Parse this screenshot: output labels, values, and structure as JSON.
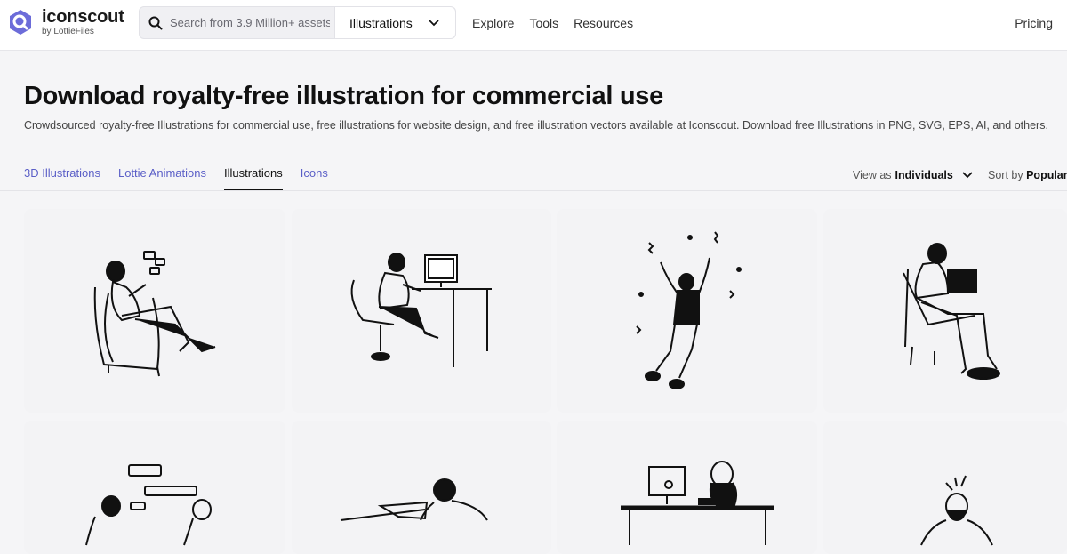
{
  "header": {
    "logo_name": "iconscout",
    "logo_sub": "by LottieFiles",
    "search_placeholder": "Search from 3.9 Million+ assets",
    "search_category": "Illustrations",
    "nav": [
      "Explore",
      "Tools",
      "Resources"
    ],
    "pricing": "Pricing"
  },
  "page": {
    "title": "Download royalty-free illustration for commercial use",
    "description": "Crowdsourced royalty-free Illustrations for commercial use, free illustrations for website design, and free illustration vectors available at Iconscout. Download free Illustrations in PNG, SVG, EPS, AI, and others."
  },
  "tabs": [
    "3D Illustrations",
    "Lottie Animations",
    "Illustrations",
    "Icons"
  ],
  "active_tab": "Illustrations",
  "view_as": {
    "label": "View as",
    "value": "Individuals"
  },
  "sort_by": {
    "label": "Sort by",
    "value": "Popular"
  },
  "colors": {
    "accent": "#5b5fc7",
    "logo": "#6c6cd9",
    "card_bg": "#f3f3f5"
  },
  "cards": [
    {
      "subject": "woman-in-armchair-with-phone"
    },
    {
      "subject": "woman-at-computer-desk"
    },
    {
      "subject": "man-jumping-celebrating"
    },
    {
      "subject": "man-on-chair-with-laptop"
    },
    {
      "subject": "people-chatting"
    },
    {
      "subject": "woman-with-paper"
    },
    {
      "subject": "stressed-person-at-desk"
    },
    {
      "subject": "man-with-idea"
    }
  ]
}
